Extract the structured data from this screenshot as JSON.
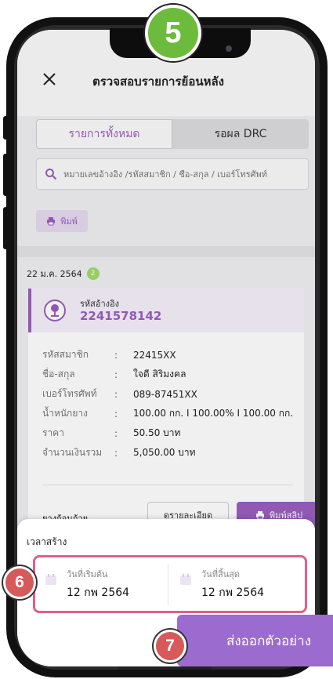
{
  "annotations": {
    "step_top": "5",
    "step_dates": "6",
    "step_export": "7"
  },
  "header": {
    "title": "ตรวจสอบรายการย้อนหลัง"
  },
  "tabs": [
    {
      "label": "รายการทั้งหมด",
      "active": true
    },
    {
      "label": "รอผล DRC",
      "active": false
    }
  ],
  "search": {
    "placeholder": "หมายเลขอ้างอิง /รหัสสมาชิก / ชื่อ-สกุล / เบอร์โทรศัพท์"
  },
  "toolbar": {
    "print_label": "พิมพ์"
  },
  "group": {
    "date": "22 ม.ค. 2564",
    "count": "2"
  },
  "card": {
    "ref_label": "รหัสอ้างอิง",
    "ref_value": "2241578142",
    "fields": [
      {
        "label": "รหัสสมาชิก",
        "value": "22415XX"
      },
      {
        "label": "ชื่อ-สกุล",
        "value": "ใจดี สิริมงคล"
      },
      {
        "label": "เบอร์โทรศัพท์",
        "value": "089-87451XX"
      },
      {
        "label": "น้ำหนักยาง",
        "value": "100.00 กก.  I 100.00%  I 100.00 กก."
      },
      {
        "label": "ราคา",
        "value": "50.50 บาท"
      },
      {
        "label": "จำนวนเงินรวม",
        "value": "5,050.00 บาท"
      }
    ],
    "rubber_type": "ยางก้อนถ้วย",
    "detail_label": "ดูรายละเอียด",
    "slip_label": "พิมพ์สลิป"
  },
  "sheet": {
    "title": "เวลาสร้าง",
    "start_label": "วันที่เริ่มต้น",
    "start_value": "12 กพ 2564",
    "end_label": "วันที่สิ้นสุด",
    "end_value": "12 กพ 2564"
  },
  "export": {
    "label": "ส่งออกตัวอย่าง"
  },
  "colors": {
    "accent": "#9b5fc0",
    "step_green": "#6dbb3c",
    "step_red": "#d65a5a",
    "highlight": "#e0608c"
  },
  "icons": {
    "close": "close-icon",
    "search": "search-icon",
    "print": "printer-icon",
    "ref": "rubber-tree-icon",
    "calendar": "calendar-icon"
  }
}
